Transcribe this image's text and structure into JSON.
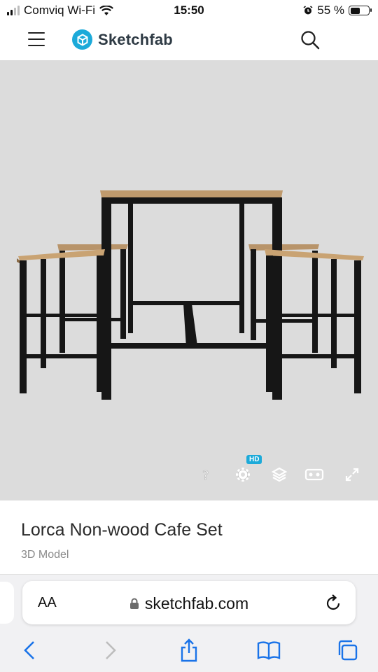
{
  "status": {
    "carrier": "Comviq Wi-Fi",
    "time": "15:50",
    "battery_text": "55 %",
    "battery_level": 0.55
  },
  "header": {
    "brand": "Sketchfab",
    "icons": [
      "menu-icon",
      "sketchfab-logo-icon",
      "search-icon"
    ]
  },
  "viewer": {
    "hd_badge": "HD",
    "tools": [
      "help-icon",
      "settings-icon",
      "layers-icon",
      "vr-icon",
      "fullscreen-icon"
    ]
  },
  "model": {
    "title": "Lorca Non-wood Cafe Set",
    "subtitle": "3D Model"
  },
  "browser": {
    "text_size_label": "AA",
    "url": "sketchfab.com",
    "nav_icons": [
      "back-icon",
      "forward-icon",
      "share-icon",
      "bookmarks-icon",
      "tabs-icon"
    ]
  },
  "colors": {
    "brand_blue": "#1caad9",
    "viewer_bg": "#dcdcdc",
    "ios_blue": "#1a73e8"
  }
}
